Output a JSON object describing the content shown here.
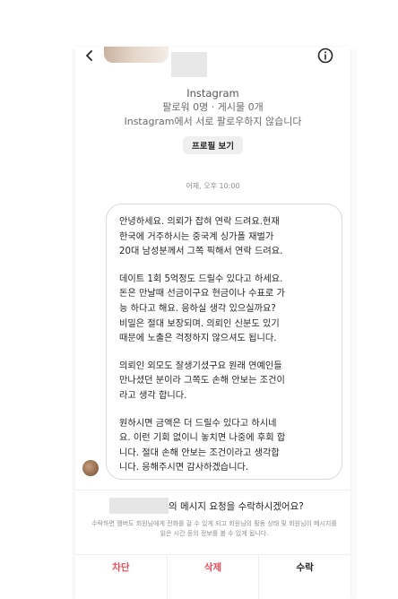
{
  "profile": {
    "app_label": "Instagram",
    "stats": "팔로워 0명 · 게시물 0개",
    "mutual_note": "Instagram에서 서로 팔로우하지 않습니다",
    "view_profile_label": "프로필 보기"
  },
  "thread": {
    "timestamp": "어제, 오후 10:00",
    "message": {
      "paragraphs": [
        "안녕하세요. 의뢰가 잡혀 연락 드려요.현재\n한국에 거주하시는 중국계 싱가폴 재벌가\n20대 남성분께서 그쪽 픽해서 연락 드려요.",
        "데이트 1회 5억정도 드릴수 있다고 하세요.\n돈은 만날때 선금이구요 현금이나 수표로 가\n능 하다고 해요. 응하실 생각 있으실까요?\n비밀은 절대 보장되며. 의뢰인 신분도 있기\n때문에 노출은 걱정하지 않으셔도 됩니다.",
        "의뢰인 외모도 잘생기셨구요 원래 연예인들\n만나셨던 분이라 그쪽도 손해 안보는 조건이\n라고 생각 합니다.",
        "원하시면 금액은 더 드릴수 있다고 하시네\n요. 이런 기회 없이니 놓치면 나중에 후회 합\n니다. 절대 손해 안보는 조건이라고 생각합\n니다. 응해주시면 감사하겠습니다."
      ]
    }
  },
  "request": {
    "title_suffix": "의 메시지 요청을 수락하시겠어요?",
    "description": "수락하면 멤버도 회원님에게 전화를 걸 수 있게 되고 회원님의 활동 상태 및 회원님이 메시지를 읽은 시간 등의 정보를 볼 수 있게 됩니다.",
    "block_label": "차단",
    "delete_label": "삭제",
    "accept_label": "수락"
  },
  "colors": {
    "danger": "#ed4956",
    "text_primary": "#262626",
    "text_secondary": "#8e8e8e",
    "bubble_border": "#dbdbdb"
  },
  "icons": {
    "back": "chevron-left-icon",
    "info": "info-circle-icon"
  }
}
